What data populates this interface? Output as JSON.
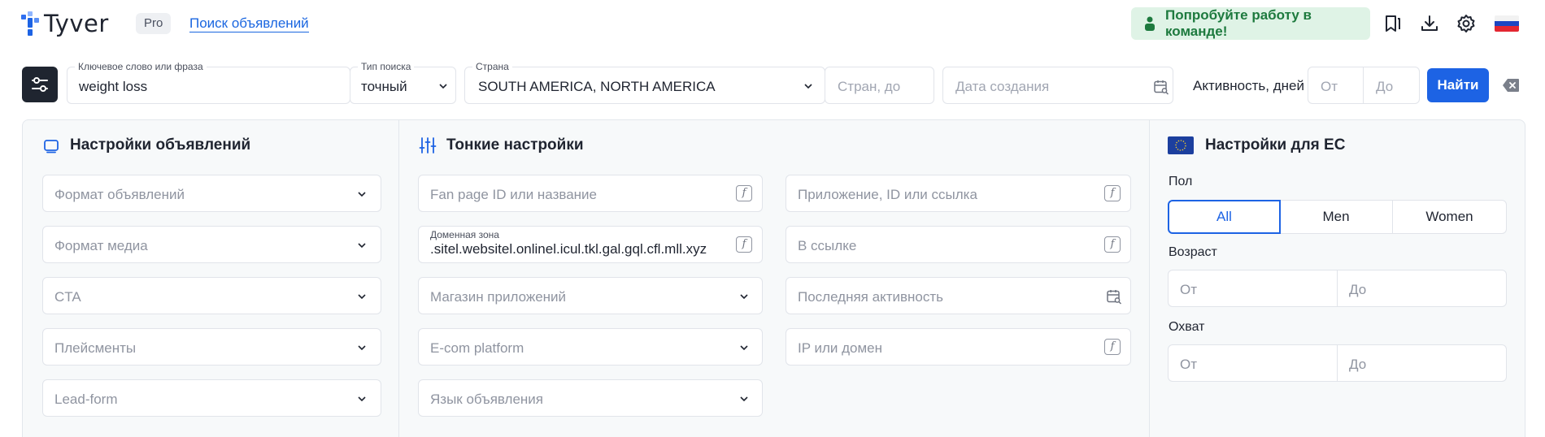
{
  "header": {
    "logo_text": "Tyver",
    "plan_badge": "Pro",
    "search_link": "Поиск объявлений",
    "team_button": "Попробуйте работу в команде!"
  },
  "filters": {
    "keyword": {
      "label": "Ключевое слово или фраза",
      "value": "weight loss"
    },
    "search_type": {
      "label": "Тип поиска",
      "value": "точный"
    },
    "country": {
      "label": "Страна",
      "value": "SOUTH AMERICA, NORTH AMERICA"
    },
    "countries_to": {
      "placeholder": "Стран, до"
    },
    "created_date": {
      "placeholder": "Дата создания"
    },
    "activity": {
      "label": "Активность, дней",
      "from_placeholder": "От",
      "to_placeholder": "До"
    },
    "find_button": "Найти"
  },
  "ad_settings": {
    "title": "Настройки объявлений",
    "selects": [
      "Формат объявлений",
      "Формат медиа",
      "CTA",
      "Плейсменты",
      "Lead-form"
    ]
  },
  "fine_settings": {
    "title": "Тонкие настройки",
    "fan_page": {
      "placeholder": "Fan page ID или название"
    },
    "domain_zone": {
      "label": "Доменная зона",
      "value": ".sitel.websitel.onlinel.icul.tkl.gal.gql.cfl.mll.xyz"
    },
    "app_store": {
      "placeholder": "Магазин приложений"
    },
    "ecom_platform": {
      "placeholder": "E-com platform"
    },
    "ad_language": {
      "placeholder": "Язык объявления"
    },
    "application": {
      "placeholder": "Приложение, ID или ссылка"
    },
    "in_link": {
      "placeholder": "В ссылке"
    },
    "last_activity": {
      "placeholder": "Последняя активность"
    },
    "ip_domain": {
      "placeholder": "IP или домен"
    }
  },
  "eu_settings": {
    "title": "Настройки для ЕС",
    "gender_label": "Пол",
    "gender_options": [
      "All",
      "Men",
      "Women"
    ],
    "gender_selected": "All",
    "age_label": "Возраст",
    "age_from": "От",
    "age_to": "До",
    "reach_label": "Охват",
    "reach_from": "От",
    "reach_to": "До"
  },
  "colors": {
    "accent": "#1d63e4",
    "team_button_bg": "#dff3e6",
    "team_button_text": "#1d7a3e",
    "filter_toggle_bg": "#1f2530"
  }
}
